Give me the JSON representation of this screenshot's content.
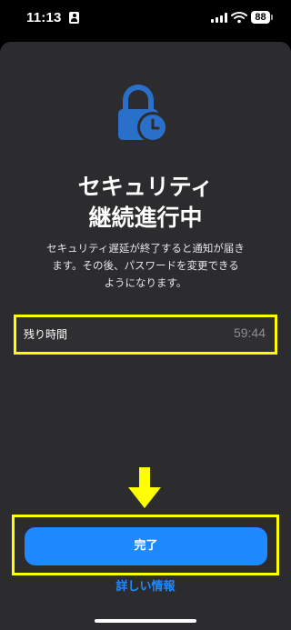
{
  "status_bar": {
    "time": "11:13",
    "battery": "88"
  },
  "icons": {
    "person": "person-badge-icon",
    "signal": "cellular-signal-icon",
    "wifi": "wifi-icon",
    "battery": "battery-icon",
    "hero": "lock-clock-icon",
    "arrow": "down-arrow-annotation"
  },
  "main": {
    "title_line1": "セキュリティ",
    "title_line2": "継続進行中",
    "description_line1": "セキュリティ遅延が終了すると通知が届き",
    "description_line2": "ます。その後、パスワードを変更できる",
    "description_line3": "ようになります。"
  },
  "remaining": {
    "label": "残り時間",
    "value": "59:44"
  },
  "actions": {
    "done_label": "完了",
    "more_info_label": "詳しい情報"
  },
  "colors": {
    "accent": "#1f8aff",
    "highlight": "#ffff00",
    "sheet_background": "#2c2c2e"
  }
}
